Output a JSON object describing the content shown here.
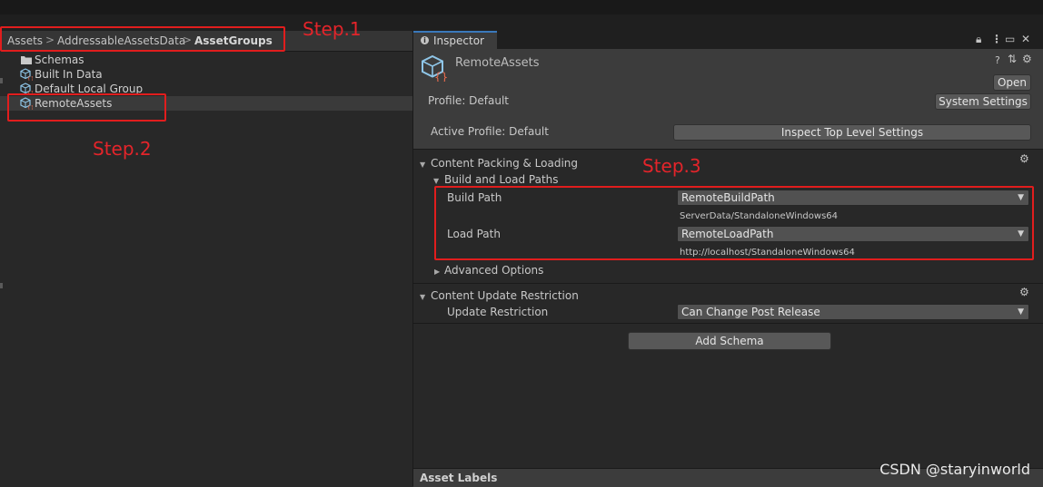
{
  "breadcrumb": {
    "items": [
      "Assets",
      "AddressableAssetsData",
      "AssetGroups"
    ],
    "separator": ">"
  },
  "tree": {
    "items": [
      {
        "label": "Schemas",
        "icon": "folder-icon"
      },
      {
        "label": "Built In Data",
        "icon": "asset-group-icon"
      },
      {
        "label": "Default Local Group",
        "icon": "asset-group-icon"
      },
      {
        "label": "RemoteAssets",
        "icon": "asset-group-icon",
        "selected": true
      }
    ]
  },
  "annotations": {
    "step1": "Step.1",
    "step2": "Step.2",
    "step3": "Step.3",
    "color": "#e11d1d"
  },
  "inspector": {
    "tab_label": "Inspector",
    "asset_name": "RemoteAssets",
    "open_label": "Open",
    "profile_label": "Profile: Default",
    "system_settings_label": "System Settings",
    "active_profile_label": "Active Profile: Default",
    "inspect_top_label": "Inspect Top Level Settings",
    "content_packing": {
      "title": "Content Packing & Loading",
      "build_load_title": "Build and Load Paths",
      "build_path_label": "Build Path",
      "build_path_value": "RemoteBuildPath",
      "build_path_resolved": "ServerData/StandaloneWindows64",
      "load_path_label": "Load Path",
      "load_path_value": "RemoteLoadPath",
      "load_path_resolved": "http://localhost/StandaloneWindows64",
      "advanced_label": "Advanced Options"
    },
    "content_update": {
      "title": "Content Update Restriction",
      "restriction_label": "Update Restriction",
      "restriction_value": "Can Change Post Release"
    },
    "add_schema_label": "Add Schema",
    "asset_labels_title": "Asset Labels"
  },
  "watermark": "CSDN @staryinworld",
  "colors": {
    "accent": "#3a79bb",
    "panel": "#282828",
    "header": "#3c3c3c"
  }
}
